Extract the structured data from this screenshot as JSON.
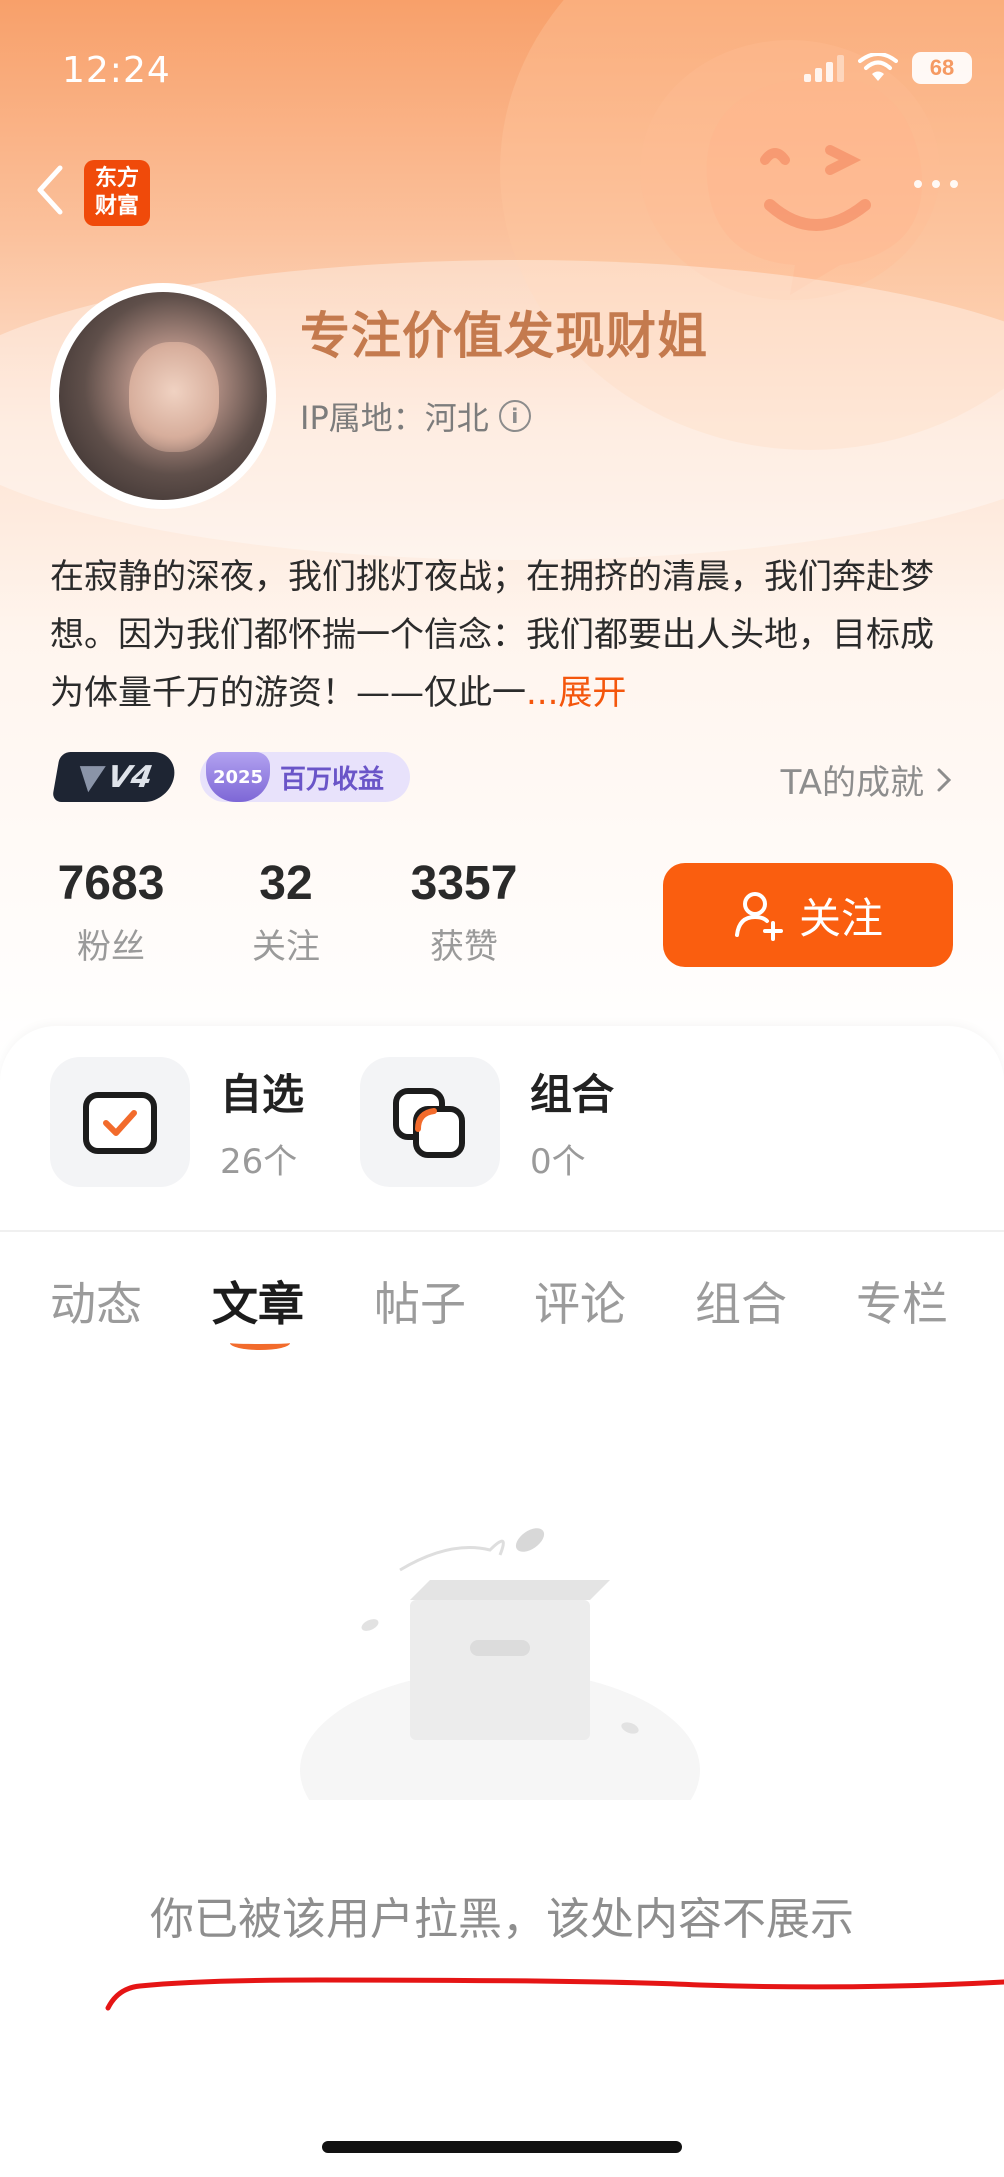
{
  "status_bar": {
    "time": "12:24",
    "battery": "68"
  },
  "nav": {
    "logo_line1": "东方",
    "logo_line2": "财富"
  },
  "profile": {
    "name": "专注价值发现财姐",
    "ip_location": "IP属地：河北",
    "bio": "在寂静的深夜，我们挑灯夜战；在拥挤的清晨，我们奔赴梦想。因为我们都怀揣一个信念：我们都要出人头地，目标成为体量千万的游资！——仅此一",
    "expand_label": "...展开"
  },
  "badges": {
    "level": "V4",
    "milestone_year": "2025",
    "milestone_label": "百万收益",
    "achievements_link": "TA的成就"
  },
  "stats": [
    {
      "value": "7683",
      "label": "粉丝"
    },
    {
      "value": "32",
      "label": "关注"
    },
    {
      "value": "3357",
      "label": "获赞"
    }
  ],
  "follow_button": "关注",
  "tiles": [
    {
      "title": "自选",
      "count": "26个"
    },
    {
      "title": "组合",
      "count": "0个"
    }
  ],
  "tabs": [
    "动态",
    "文章",
    "帖子",
    "评论",
    "组合",
    "专栏"
  ],
  "active_tab": "文章",
  "empty_state": {
    "message": "你已被该用户拉黑，该处内容不展示"
  },
  "colors": {
    "accent": "#fa5e0f",
    "name_color": "#c47a4e",
    "annotation_red": "#e51515"
  }
}
